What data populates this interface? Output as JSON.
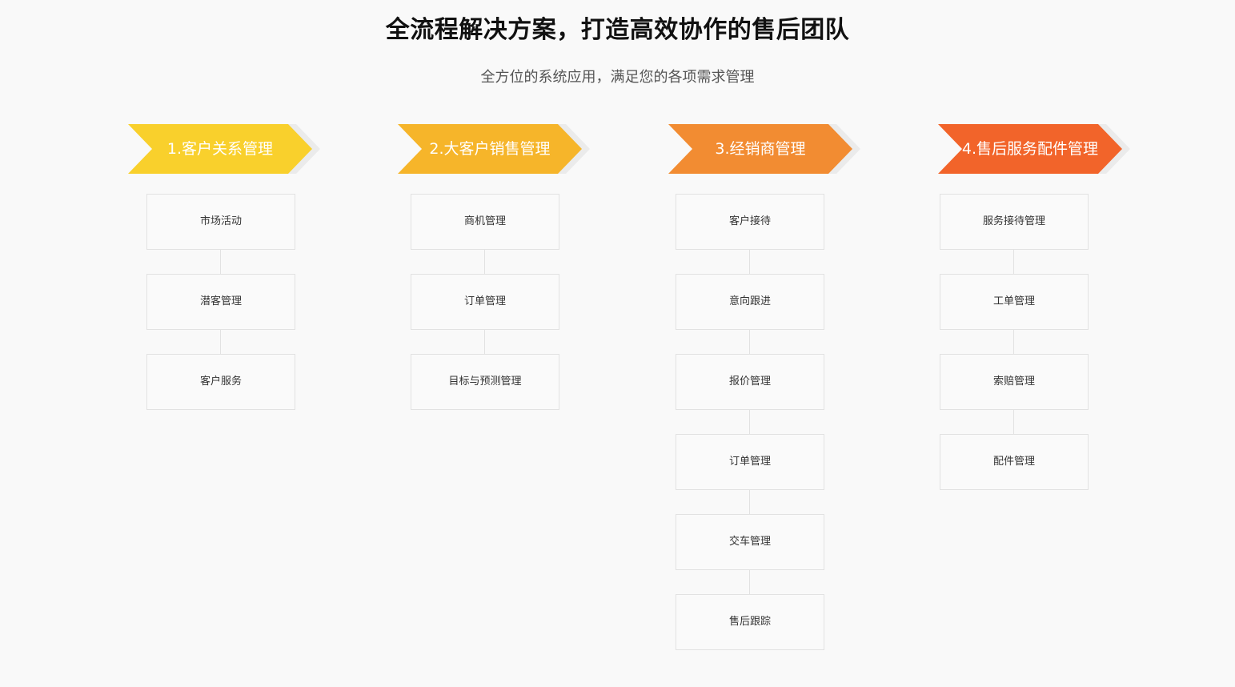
{
  "header": {
    "title": "全流程解决方案，打造高效协作的售后团队",
    "subtitle": "全方位的系统应用，满足您的各项需求管理"
  },
  "columns": [
    {
      "label": "1.客户关系管理",
      "color": "#f9d02c",
      "items": [
        "市场活动",
        "潜客管理",
        "客户服务"
      ]
    },
    {
      "label": "2.大客户销售管理",
      "color": "#f6b52a",
      "items": [
        "商机管理",
        "订单管理",
        "目标与预测管理"
      ]
    },
    {
      "label": "3.经销商管理",
      "color": "#f28c32",
      "items": [
        "客户接待",
        "意向跟进",
        "报价管理",
        "订单管理",
        "交车管理",
        "售后跟踪"
      ]
    },
    {
      "label": "4.售后服务配件管理",
      "color": "#f2642a",
      "items": [
        "服务接待管理",
        "工单管理",
        "索赔管理",
        "配件管理"
      ]
    }
  ]
}
